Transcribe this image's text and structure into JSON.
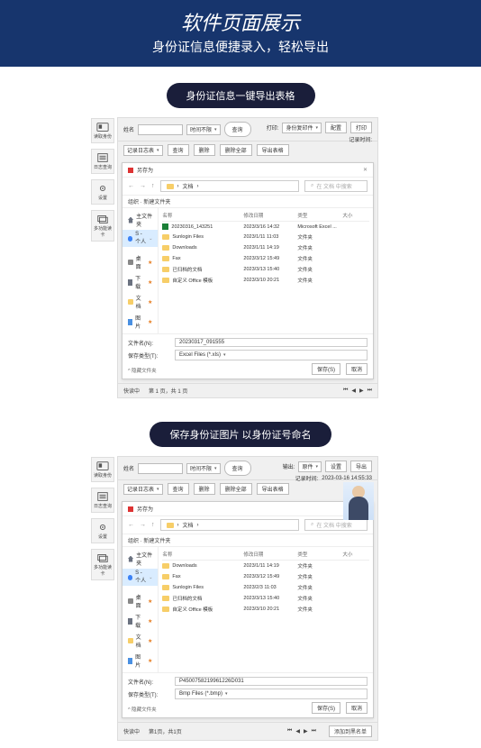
{
  "header": {
    "title": "软件页面展示",
    "sub": "身份证信息便捷录入，轻松导出"
  },
  "pill1": "身份证信息一键导出表格",
  "pill2": "保存身份证图片 以身份证号命名",
  "side": [
    {
      "label": "读取身份"
    },
    {
      "label": "日志查询"
    },
    {
      "label": "设置"
    },
    {
      "label": "多功能读卡"
    }
  ],
  "panel1": {
    "name_label": "姓名",
    "time_label": "时间不限",
    "query_btn": "查询",
    "log_select": "记录日志表",
    "btn_query": "查询",
    "btn_del": "删除",
    "btn_delall": "删除全部",
    "btn_export": "导出表格",
    "print_label": "打印:",
    "print_select": "身份复印件",
    "print_cfg": "配置",
    "print_btn": "打印",
    "records": "记录时间:",
    "quick": "快读中",
    "page": "第 1 页，共 1 页",
    "dialog": {
      "title": "另存为",
      "path_label": "文档",
      "search_ph": "在 文档 中搜索",
      "tabs": "组织 · 新建文件夹",
      "side": [
        {
          "k": "host",
          "label": "主文件夹"
        },
        {
          "k": "cloud",
          "label": "S - 个人"
        },
        {
          "k": "desk",
          "label": "桌面"
        },
        {
          "k": "dl",
          "label": "下载"
        },
        {
          "k": "doc",
          "label": "文档"
        },
        {
          "k": "pic",
          "label": "图片"
        }
      ],
      "hdr": {
        "c1": "名称",
        "c2": "修改日期",
        "c3": "类型",
        "c4": "大小"
      },
      "rows": [
        {
          "ico": "xls",
          "name": "20230316_143251",
          "date": "2023/3/16 14:32",
          "type": "Microsoft Excel ..."
        },
        {
          "ico": "fld",
          "name": "Sunlogin Files",
          "date": "2023/1/11 11:03",
          "type": "文件夹"
        },
        {
          "ico": "fld",
          "name": "Downloads",
          "date": "2023/1/11 14:19",
          "type": "文件夹"
        },
        {
          "ico": "fld",
          "name": "Fax",
          "date": "2023/3/12 15:49",
          "type": "文件夹"
        },
        {
          "ico": "fld",
          "name": "已归档的文档",
          "date": "2023/3/13 15:40",
          "type": "文件夹"
        },
        {
          "ico": "fld",
          "name": "自定义 Office 模板",
          "date": "2023/3/10 20:21",
          "type": "文件夹"
        }
      ],
      "fname_label": "文件名(N):",
      "fname_value": "20230317_091555",
      "ftype_label": "保存类型(T):",
      "ftype_value": "Excel Files (*.xls)",
      "hide": "^ 隐藏文件夹",
      "save": "保存(S)",
      "cancel": "取消"
    }
  },
  "panel2": {
    "print_label": "输出:",
    "print_select": "原件",
    "print_cfg": "设置",
    "print_btn": "导出",
    "records": "记录时间:",
    "records_time": "2023-03-16 14:55:33",
    "page": "第1页，共1页",
    "addbl": "添加到黑名单",
    "dialog": {
      "path_label": "文档",
      "search_ph": "在 文档 中搜索",
      "title": "另存为",
      "tabs": "组织 · 新建文件夹",
      "side": [
        {
          "k": "host",
          "label": "主文件夹"
        },
        {
          "k": "cloud",
          "label": "S - 个人"
        },
        {
          "k": "desk",
          "label": "桌面"
        },
        {
          "k": "dl",
          "label": "下载"
        },
        {
          "k": "doc",
          "label": "文档"
        },
        {
          "k": "pic",
          "label": "图片"
        }
      ],
      "hdr": {
        "c1": "名称",
        "c2": "修改日期",
        "c3": "类型",
        "c4": "大小"
      },
      "rows": [
        {
          "ico": "fld",
          "name": "Downloads",
          "date": "2023/1/11 14:19",
          "type": "文件夹"
        },
        {
          "ico": "fld",
          "name": "Fax",
          "date": "2023/3/12 15:49",
          "type": "文件夹"
        },
        {
          "ico": "fld",
          "name": "Sunlogin Files",
          "date": "2023/2/3 11:03",
          "type": "文件夹"
        },
        {
          "ico": "fld",
          "name": "已归档的文档",
          "date": "2023/3/13 15:40",
          "type": "文件夹"
        },
        {
          "ico": "fld",
          "name": "自定义 Office 模板",
          "date": "2023/3/10 20:21",
          "type": "文件夹"
        }
      ],
      "fname_label": "文件名(N):",
      "fname_value": "P4500758219961226D031",
      "ftype_label": "保存类型(T):",
      "ftype_value": "Bmp Files (*.bmp)",
      "hide": "^ 隐藏文件夹",
      "save": "保存(S)",
      "cancel": "取消"
    }
  }
}
